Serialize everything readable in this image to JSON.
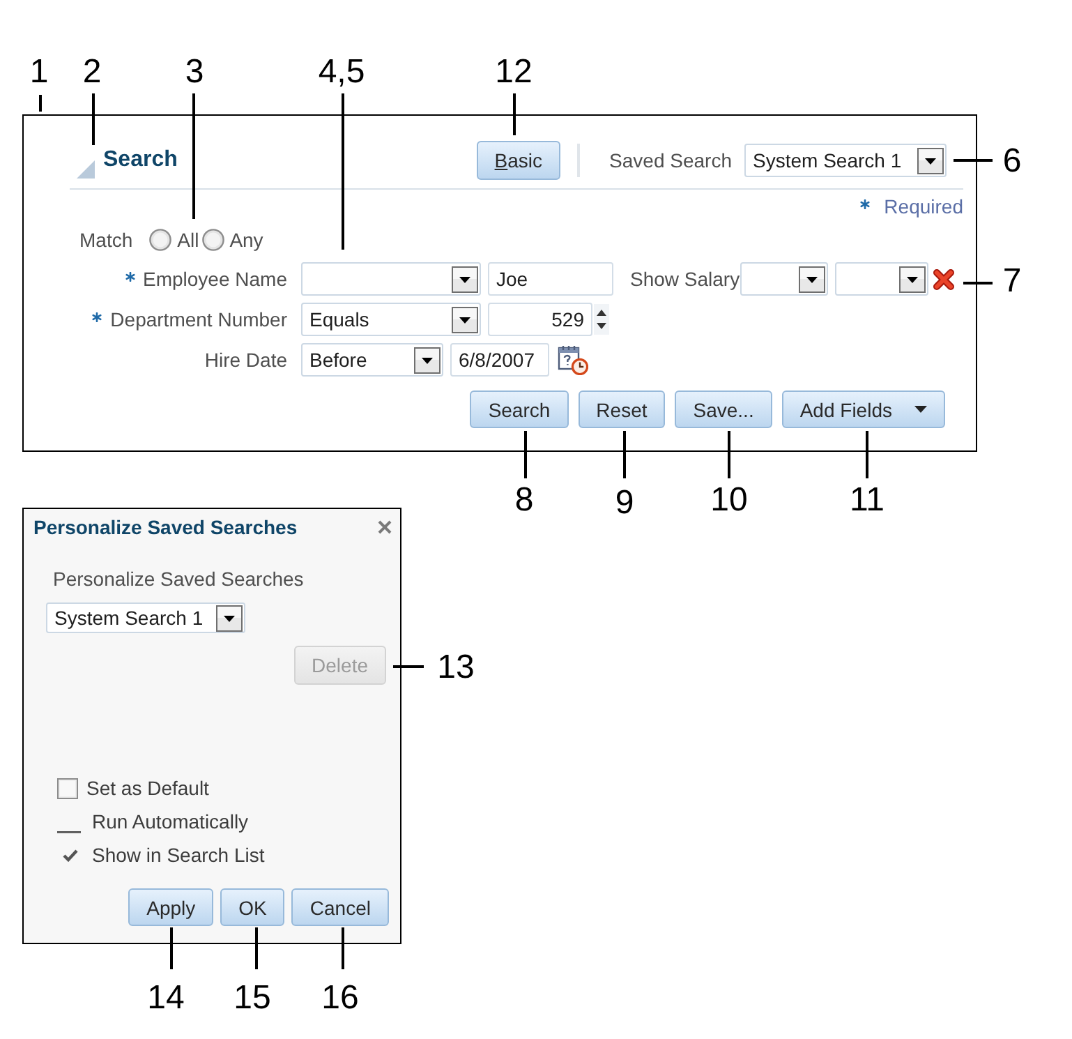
{
  "search_panel": {
    "title": "Search",
    "mode_button": {
      "label": "Basic"
    },
    "saved_search": {
      "label": "Saved Search",
      "value": "System Search 1"
    },
    "required_note": {
      "label": "Required"
    },
    "match": {
      "label": "Match",
      "options": [
        {
          "label": "All",
          "selected": false
        },
        {
          "label": "Any",
          "selected": false
        }
      ]
    },
    "rows": [
      {
        "fields": [
          {
            "kind": "text",
            "label": "Employee Name",
            "required": true,
            "value": "Joe",
            "removable": false
          },
          {
            "kind": "choice",
            "label": "Show Salary",
            "required": false,
            "removable": true
          }
        ]
      },
      {
        "fields": [
          {
            "kind": "number",
            "label": "Department Number",
            "required": true,
            "operator": "Equals",
            "value": "529",
            "removable": false
          }
        ]
      },
      {
        "fields": [
          {
            "kind": "date",
            "label": "Hire Date",
            "required": false,
            "operator": "Before",
            "value": "6/8/2007",
            "removable": false
          }
        ]
      }
    ],
    "buttons": [
      {
        "kind": "plain",
        "label": "Search"
      },
      {
        "kind": "plain",
        "label": "Reset"
      },
      {
        "kind": "plain",
        "label": "Save..."
      },
      {
        "kind": "menu",
        "label": "Add Fields"
      }
    ]
  },
  "dialog": {
    "title": "Personalize Saved Searches",
    "label": "Personalize Saved Searches",
    "saved_search_value": "System Search 1",
    "delete_button": {
      "label": "Delete",
      "disabled": true
    },
    "options": [
      {
        "kind": "checkbox",
        "label": "Set as Default",
        "checked": false
      },
      {
        "kind": "readonly",
        "label": "Run Automatically",
        "checked": false
      },
      {
        "kind": "readonly",
        "label": "Show in Search List",
        "checked": true
      }
    ],
    "buttons": [
      {
        "label": "Apply"
      },
      {
        "label": "OK"
      },
      {
        "label": "Cancel"
      }
    ]
  },
  "callouts": [
    "1",
    "2",
    "3",
    "4,5",
    "12",
    "6",
    "7",
    "8",
    "9",
    "10",
    "11",
    "13",
    "14",
    "15",
    "16"
  ]
}
